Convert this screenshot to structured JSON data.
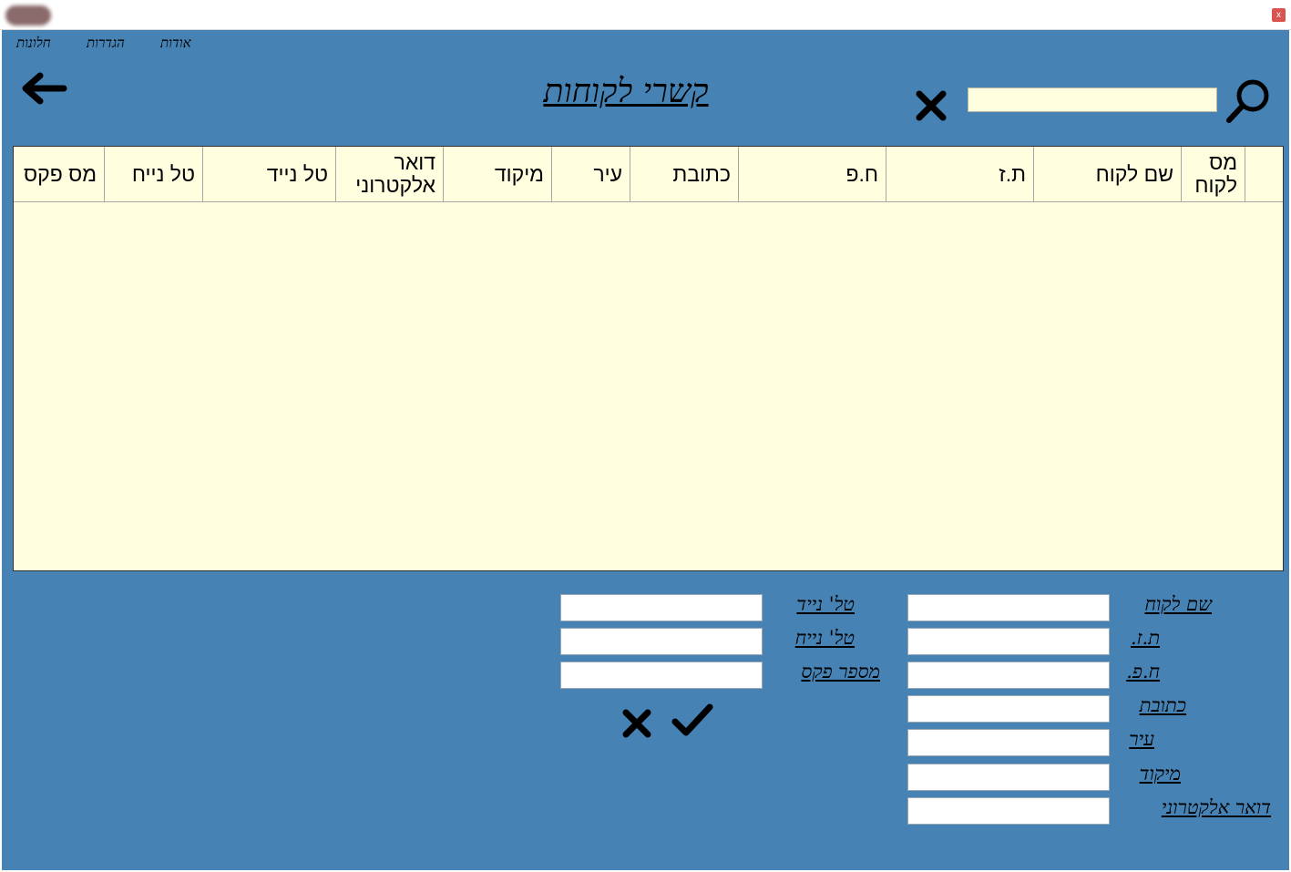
{
  "window": {
    "close_label": "x"
  },
  "menu": {
    "items": [
      "חלונות",
      "הגדרות",
      "אודות"
    ]
  },
  "header": {
    "title": "קשרי לקוחות",
    "search_value": ""
  },
  "grid": {
    "columns": [
      "מס לקוח",
      "שם לקוח",
      "ת.ז",
      "ח.פ",
      "כתובת",
      "עיר",
      "מיקוד",
      "דואר אלקטרוני",
      "טל נייד",
      "טל נייח",
      "מס פקס"
    ],
    "rows": []
  },
  "form": {
    "fields_right": [
      {
        "label": "שם לקוח",
        "value": ""
      },
      {
        "label": "ת.ז.",
        "value": ""
      },
      {
        "label": "ח.פ.",
        "value": ""
      },
      {
        "label": "כתובת",
        "value": ""
      },
      {
        "label": "עיר",
        "value": ""
      },
      {
        "label": "מיקוד",
        "value": ""
      },
      {
        "label": "דואר אלקטרוני",
        "value": ""
      }
    ],
    "fields_left": [
      {
        "label": "טל' נייד",
        "value": ""
      },
      {
        "label": "טל' נייח",
        "value": ""
      },
      {
        "label": "מספר פקס",
        "value": ""
      }
    ]
  },
  "icons": {
    "back": "arrow-left-icon",
    "clear": "x-icon",
    "search": "magnifier-icon",
    "confirm": "check-icon",
    "cancel": "x-icon"
  },
  "colors": {
    "window_bg": "#4682b4",
    "grid_bg": "#ffffe0",
    "search_bg": "#ffffe0",
    "input_bg": "#ffffff",
    "text": "#000000"
  }
}
